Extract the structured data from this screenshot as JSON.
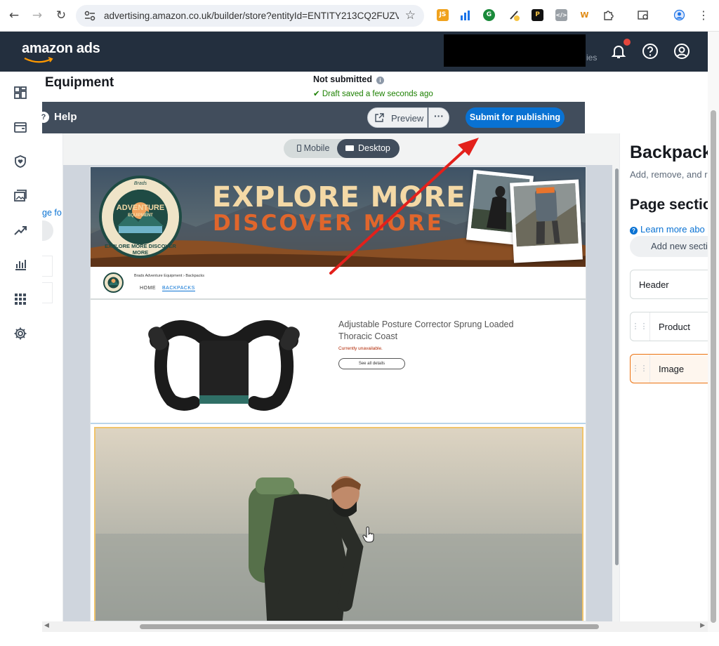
{
  "browser": {
    "url": "advertising.amazon.co.uk/builder/store?entityId=ENTITY213CQ2FUZV...",
    "extensions": [
      "JS",
      "chart-extension",
      "G",
      "pen-extension",
      "P",
      "code-extension",
      "W",
      "puzzle-icon"
    ]
  },
  "header": {
    "logo": "amazon ads",
    "truncated_text": "ies"
  },
  "builder": {
    "page_title": "Equipment",
    "status": "Not submitted",
    "draft_status": "Draft saved a few seconds ago",
    "help_label": "Help",
    "preview_label": "Preview",
    "more_label": "···",
    "submit_label": "Submit for publishing",
    "left_stub_link": "ge fo"
  },
  "view_toggle": {
    "mobile_label": "Mobile",
    "desktop_label": "Desktop",
    "selected": "Desktop"
  },
  "store_preview": {
    "hero_line1": "EXPLORE MORE",
    "hero_line2": "DISCOVER MORE",
    "badge_script": "Brads",
    "badge_brand": "ADVENTURE",
    "badge_sub": "EQUIPMENT",
    "badge_motto": "EXPLORE MORE DISCOVER MORE",
    "breadcrumb": "Brads Adventure Equipment  ›  Backpacks",
    "nav_home": "HOME",
    "nav_backpacks": "BACKPACKS",
    "product_title": "Adjustable Posture Corrector Sprung Loaded Thoracic Coast",
    "product_status": "Currently unavailable.",
    "product_button": "See all details"
  },
  "right_panel": {
    "title": "Backpacks",
    "subtitle": "Add, remove, and r",
    "sections_heading": "Page sectio",
    "learn_more": "Learn more abo",
    "add_section": "Add new sectio",
    "sections": [
      {
        "label": "Header",
        "draggable": false,
        "selected": false
      },
      {
        "label": "Product",
        "draggable": true,
        "selected": false
      },
      {
        "label": "Image",
        "draggable": true,
        "selected": true
      }
    ]
  },
  "colors": {
    "header_bg": "#232f3e",
    "builder_bar": "#414d5c",
    "primary_button": "#0972d3",
    "selected_border": "#ec7211",
    "annotation_arrow": "#e3201b"
  }
}
